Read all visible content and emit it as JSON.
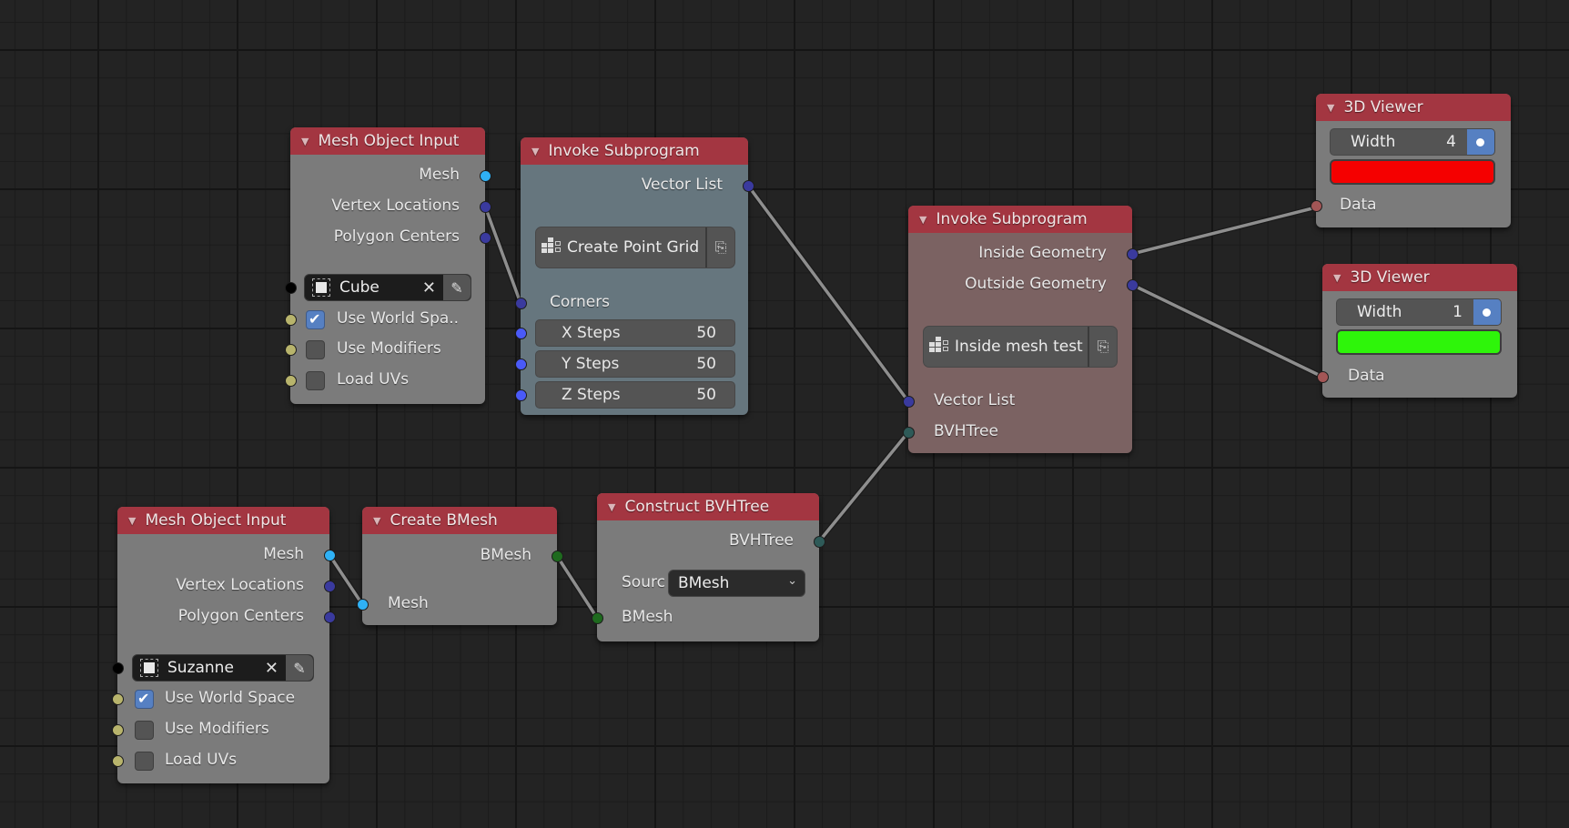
{
  "nodes": {
    "mesh_input_1": {
      "title": "Mesh Object Input",
      "outputs": [
        "Mesh",
        "Vertex Locations",
        "Polygon Centers"
      ],
      "object": "Cube",
      "options": [
        {
          "label": "Use World Spa..",
          "checked": true
        },
        {
          "label": "Use Modifiers",
          "checked": false
        },
        {
          "label": "Load UVs",
          "checked": false
        }
      ]
    },
    "invoke_1": {
      "title": "Invoke Subprogram",
      "outputs": [
        "Vector List"
      ],
      "subprogram": "Create Point Grid",
      "inputs": [
        "Corners"
      ],
      "fields": [
        {
          "label": "X Steps",
          "value": "50"
        },
        {
          "label": "Y Steps",
          "value": "50"
        },
        {
          "label": "Z Steps",
          "value": "50"
        }
      ]
    },
    "invoke_2": {
      "title": "Invoke Subprogram",
      "outputs": [
        "Inside Geometry",
        "Outside Geometry"
      ],
      "subprogram": "Inside mesh test",
      "inputs": [
        "Vector List",
        "BVHTree"
      ]
    },
    "viewer_1": {
      "title": "3D Viewer",
      "width_label": "Width",
      "width_value": "4",
      "color": "#f50000",
      "input": "Data"
    },
    "viewer_2": {
      "title": "3D Viewer",
      "width_label": "Width",
      "width_value": "1",
      "color": "#2ef50a",
      "input": "Data"
    },
    "mesh_input_2": {
      "title": "Mesh Object Input",
      "outputs": [
        "Mesh",
        "Vertex Locations",
        "Polygon Centers"
      ],
      "object": "Suzanne",
      "options": [
        {
          "label": "Use World Space",
          "checked": true
        },
        {
          "label": "Use Modifiers",
          "checked": false
        },
        {
          "label": "Load UVs",
          "checked": false
        }
      ]
    },
    "create_bmesh": {
      "title": "Create BMesh",
      "outputs": [
        "BMesh"
      ],
      "inputs": [
        "Mesh"
      ]
    },
    "construct_bvh": {
      "title": "Construct BVHTree",
      "outputs": [
        "BVHTree"
      ],
      "source_label": "Sourc",
      "source_value": "BMesh",
      "inputs": [
        "BMesh"
      ]
    }
  },
  "icons": {
    "collapse": "▼",
    "clear": "✕",
    "eyedropper": "✎",
    "add_subprogram": "⎘",
    "chevron_down": "⌄"
  }
}
